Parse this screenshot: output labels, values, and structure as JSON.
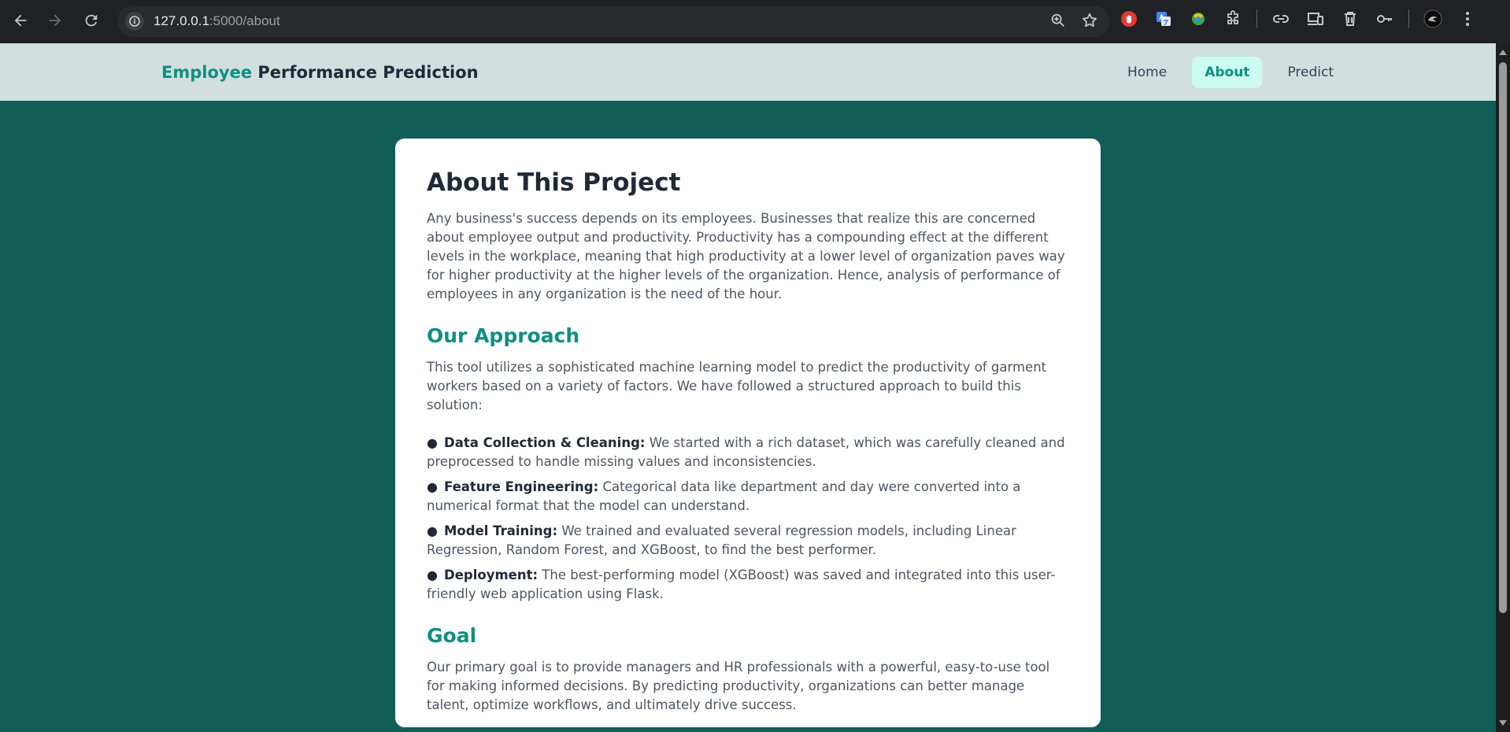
{
  "browser": {
    "url_host": "127.0.0.1",
    "url_path": ":5000/about"
  },
  "header": {
    "brand_accent": "Employee",
    "brand_rest": " Performance Prediction",
    "nav": [
      {
        "label": "Home"
      },
      {
        "label": "About"
      },
      {
        "label": "Predict"
      }
    ]
  },
  "content": {
    "title": "About This Project",
    "intro": "Any business's success depends on its employees. Businesses that realize this are concerned about employee output and productivity. Productivity has a compounding effect at the different levels in the workplace, meaning that high productivity at a lower level of organization paves way for higher productivity at the higher levels of the organization. Hence, analysis of performance of employees in any organization is the need of the hour.",
    "approach_heading": "Our Approach",
    "approach_text": "This tool utilizes a sophisticated machine learning model to predict the productivity of garment workers based on a variety of factors. We have followed a structured approach to build this solution:",
    "steps": [
      {
        "label": "Data Collection & Cleaning:",
        "text": " We started with a rich dataset, which was carefully cleaned and preprocessed to handle missing values and inconsistencies."
      },
      {
        "label": "Feature Engineering:",
        "text": " Categorical data like department and day were converted into a numerical format that the model can understand."
      },
      {
        "label": "Model Training:",
        "text": " We trained and evaluated several regression models, including Linear Regression, Random Forest, and XGBoost, to find the best performer."
      },
      {
        "label": "Deployment:",
        "text": " The best-performing model (XGBoost) was saved and integrated into this user-friendly web application using Flask."
      }
    ],
    "goal_heading": "Goal",
    "goal_text": "Our primary goal is to provide managers and HR professionals with a powerful, easy-to-use tool for making informed decisions. By predicting productivity, organizations can better manage talent, optimize workflows, and ultimately drive success."
  },
  "colors": {
    "page_bg": "#115e59",
    "accent": "#0f8f80",
    "header_bg": "#d1dfdf"
  }
}
